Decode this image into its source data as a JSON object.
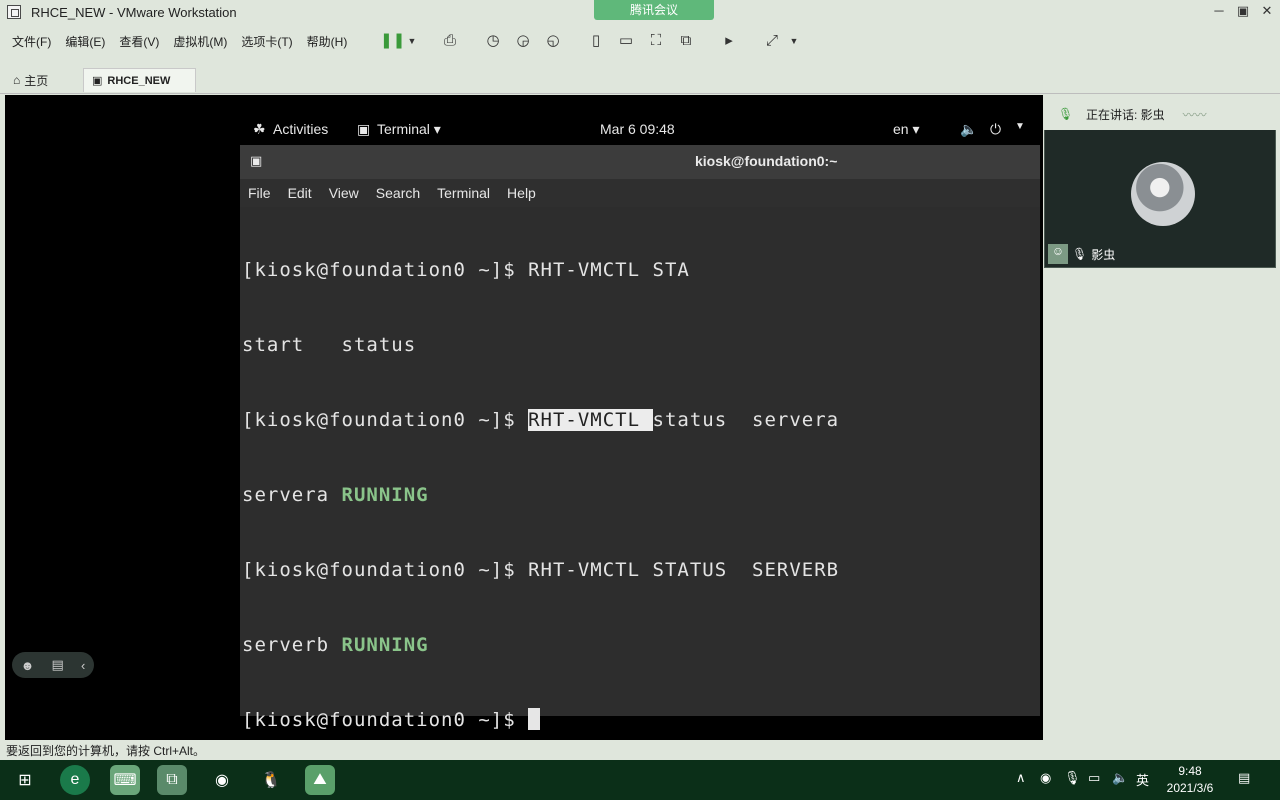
{
  "window": {
    "title": "RHCE_NEW - VMware Workstation",
    "meeting_tag": "腾讯会议"
  },
  "menubar": [
    "文件(F)",
    "编辑(E)",
    "查看(V)",
    "虚拟机(M)",
    "选项卡(T)",
    "帮助(H)"
  ],
  "tabs": [
    {
      "label": "主页"
    },
    {
      "label": "RHCE_NEW"
    }
  ],
  "gnome": {
    "activities": "Activities",
    "app": "Terminal ▾",
    "clock": "Mar 6  09:48",
    "lang": "en ▾"
  },
  "terminal": {
    "title": "kiosk@foundation0:~",
    "menu": [
      "File",
      "Edit",
      "View",
      "Search",
      "Terminal",
      "Help"
    ],
    "lines": [
      {
        "prompt": "[kiosk@foundation0 ~]$ ",
        "cmd": "RHT-VMCTL STA"
      },
      {
        "text": "start   status"
      },
      {
        "prompt": "[kiosk@foundation0 ~]$ ",
        "sel": "RHT-VMCTL ",
        "cmd": "status  servera"
      },
      {
        "text": "servera ",
        "status": "RUNNING"
      },
      {
        "prompt": "[kiosk@foundation0 ~]$ ",
        "cmd": "RHT-VMCTL STATUS  SERVERB"
      },
      {
        "text": "serverb ",
        "status": "RUNNING"
      },
      {
        "prompt": "[kiosk@foundation0 ~]$ "
      }
    ]
  },
  "meeting": {
    "speaking_label": "正在讲话: 影虫",
    "user_name": "影虫"
  },
  "statusbar": {
    "text": "要返回到您的计算机，请按 Ctrl+Alt。"
  },
  "taskbar": {
    "time": "9:48",
    "date": "2021/3/6",
    "ime": "英"
  }
}
